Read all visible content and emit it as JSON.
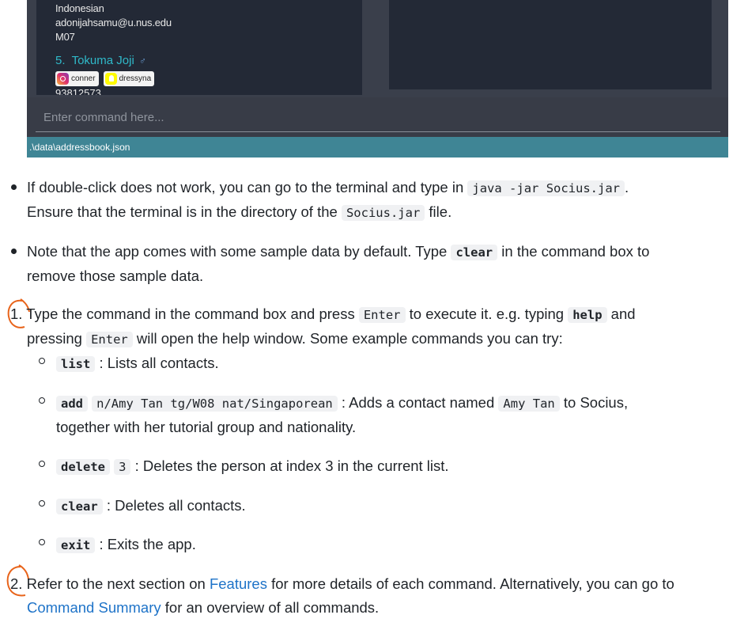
{
  "app": {
    "card_lines": [
      "Indonesian",
      "adonijahsamu@u.nus.edu",
      "M07"
    ],
    "person_index": "5.",
    "person_name": "Tokuma Joji",
    "gender_icon": "male-sign-icon",
    "tags": [
      {
        "icon": "instagram-icon",
        "label": "conner"
      },
      {
        "icon": "snapchat-icon",
        "label": "dressyna"
      }
    ],
    "phone": "93812573",
    "command_placeholder": "Enter command here...",
    "status_path": ".\\data\\addressbook.json"
  },
  "bullets": {
    "b1_part1": "If double-click does not work, you can go to the terminal and type in",
    "b1_code1": "java -jar Socius.jar",
    "b1_part2": ".",
    "b1_part3": "Ensure that the terminal is in the directory of the",
    "b1_code2": "Socius.jar",
    "b1_part4": "file.",
    "b2_part1": "Note that the app comes with some sample data by default. Type",
    "b2_code": "clear",
    "b2_part2": "in the command box to",
    "b2_part3": "remove those sample data."
  },
  "steps": {
    "s1_num": "1.",
    "s1_part1": "Type the command in the command box and press",
    "s1_code1": "Enter",
    "s1_part2": "to execute it. e.g. typing",
    "s1_code2": "help",
    "s1_part3": "and",
    "s1_part4": "pressing",
    "s1_code3": "Enter",
    "s1_part5": "will open the help window. Some example commands you can try:",
    "examples": {
      "list_cmd": "list",
      "list_desc": ": Lists all contacts.",
      "add_cmd": "add",
      "add_args": "n/Amy Tan tg/W08 nat/Singaporean",
      "add_desc1": ": Adds a contact named",
      "add_name": "Amy Tan",
      "add_desc2": "to Socius,",
      "add_desc3": "together with her tutorial group and nationality.",
      "delete_cmd": "delete",
      "delete_arg": "3",
      "delete_desc": ": Deletes the person at index 3 in the current list.",
      "clear_cmd": "clear",
      "clear_desc": ": Deletes all contacts.",
      "exit_cmd": "exit",
      "exit_desc": ": Exits the app."
    },
    "s2_num": "2.",
    "s2_part1": "Refer to the next section on",
    "s2_link1": "Features",
    "s2_part2": "for more details of each command. Alternatively, you can go to",
    "s2_link2": "Command Summary",
    "s2_part3": "for an overview of all commands."
  },
  "colors": {
    "annotation": "#e8641b",
    "link": "#1e73c8",
    "status_bar": "#3f8595",
    "name": "#2fb9c9"
  }
}
